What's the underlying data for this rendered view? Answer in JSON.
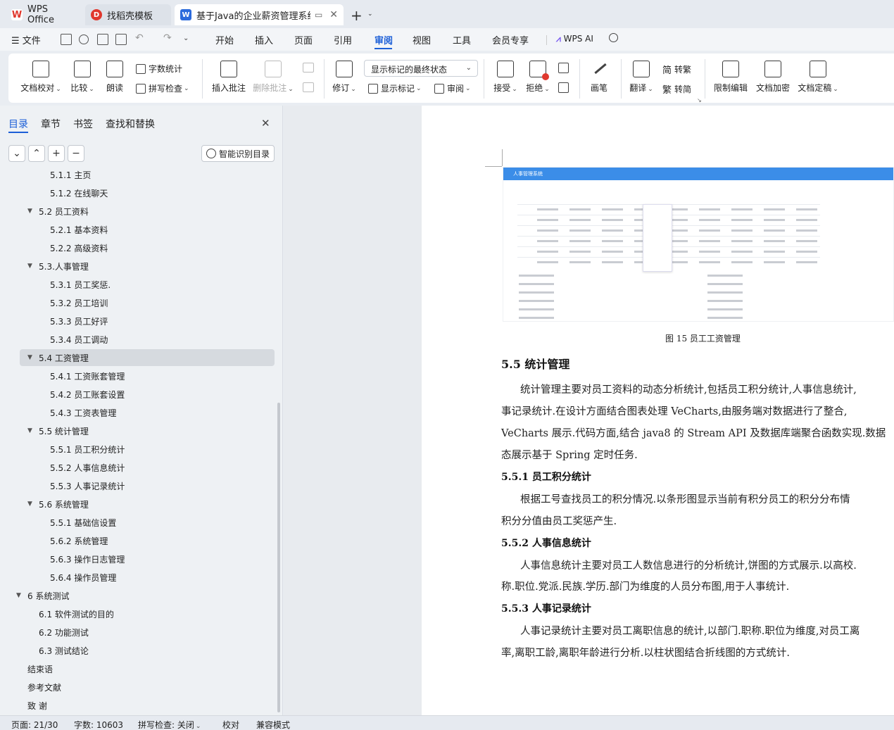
{
  "tabs": [
    {
      "label": "WPS Office",
      "icon": "wps-logo-icon",
      "color": "#e0382e"
    },
    {
      "label": "找稻壳模板",
      "icon": "docer-icon",
      "color": "#e0382e"
    },
    {
      "label": "基于Java的企业薪资管理系统",
      "icon": "word-doc-icon",
      "color": "#2c6bdc"
    }
  ],
  "menu": {
    "file": "文件",
    "items": [
      "开始",
      "插入",
      "页面",
      "引用",
      "审阅",
      "视图",
      "工具",
      "会员专享"
    ],
    "active": "审阅",
    "ai": "WPS AI"
  },
  "ribbon": {
    "doc_proof": "文档校对",
    "compare": "比较",
    "read_aloud": "朗读",
    "word_count": "字数统计",
    "spell_check": "拼写检查",
    "insert_comment": "插入批注",
    "delete_comment": "删除批注",
    "track_changes": "修订",
    "markup_state": "显示标记的最终状态",
    "show_markup": "显示标记",
    "review": "审阅",
    "accept": "接受",
    "reject": "拒绝",
    "pen": "画笔",
    "translate": "翻译",
    "to_traditional": "转繁",
    "to_simplified": "转简",
    "restrict_edit": "限制编辑",
    "encrypt": "文档加密",
    "finalize": "文档定稿"
  },
  "nav": {
    "tabs": [
      "目录",
      "章节",
      "书签",
      "查找和替换"
    ],
    "smart_toc": "智能识别目录",
    "toc": [
      {
        "label": "5.1.1 主页",
        "level": 3
      },
      {
        "label": "5.1.2 在线聊天",
        "level": 3
      },
      {
        "label": "5.2  员工资料",
        "level": 2,
        "expanded": true
      },
      {
        "label": "5.2.1 基本资料",
        "level": 3
      },
      {
        "label": "5.2.2  高级资料",
        "level": 3
      },
      {
        "label": "5.3.人事管理",
        "level": 2,
        "expanded": true
      },
      {
        "label": "5.3.1 员工奖惩.",
        "level": 3
      },
      {
        "label": "5.3.2 员工培训",
        "level": 3
      },
      {
        "label": "5.3.3 员工好评",
        "level": 3
      },
      {
        "label": "5.3.4 员工调动",
        "level": 3
      },
      {
        "label": "5.4 工资管理",
        "level": 2,
        "expanded": true,
        "selected": true
      },
      {
        "label": "5.4.1 工资账套管理",
        "level": 3
      },
      {
        "label": "5.4.2 员工账套设置",
        "level": 3
      },
      {
        "label": "5.4.3 工资表管理",
        "level": 3
      },
      {
        "label": "5.5 统计管理",
        "level": 2,
        "expanded": true
      },
      {
        "label": "5.5.1 员工积分统计",
        "level": 3
      },
      {
        "label": "5.5.2 人事信息统计",
        "level": 3
      },
      {
        "label": "5.5.3 人事记录统计",
        "level": 3
      },
      {
        "label": "5.6 系统管理",
        "level": 2,
        "expanded": true
      },
      {
        "label": "5.5.1 基础信设置",
        "level": 3
      },
      {
        "label": "5.6.2 系统管理",
        "level": 3
      },
      {
        "label": "5.6.3 操作日志管理",
        "level": 3
      },
      {
        "label": "5.6.4 操作员管理",
        "level": 3
      },
      {
        "label": "6 系统测试",
        "level": 1,
        "expanded": true
      },
      {
        "label": "6.1  软件测试的目的",
        "level": 2
      },
      {
        "label": "6.2  功能测试",
        "level": 2
      },
      {
        "label": "6.3  测试结论",
        "level": 2
      },
      {
        "label": "结束语",
        "level": 1
      },
      {
        "label": "参考文献",
        "level": 1
      },
      {
        "label": "致   谢",
        "level": 1
      }
    ]
  },
  "document": {
    "figure_title": "人事管理系统",
    "caption": "图 15 员工工资管理",
    "section": "5.5 统计管理",
    "p1": [
      "统计管理主要对员工资料的动态分析统计,包括员工积分统计,人事信息统计,",
      "事记录统计.在设计方面结合图表处理 VeCharts,由服务端对数据进行了整合,",
      "VeCharts 展示.代码方面,结合 java8 的 Stream API 及数据库端聚合函数实现.数据",
      "态展示基于 Spring 定时任务."
    ],
    "h551": "5.5.1 员工积分统计",
    "p2": [
      "根据工号查找员工的积分情况.以条形图显示当前有积分员工的积分分布情",
      "积分分值由员工奖惩产生."
    ],
    "h552": "5.5.2 人事信息统计",
    "p3": [
      "人事信息统计主要对员工人数信息进行的分析统计,饼图的方式展示.以高校.",
      "称.职位.党派.民族.学历.部门为维度的人员分布图,用于人事统计."
    ],
    "h553": "5.5.3 人事记录统计",
    "p4": [
      "人事记录统计主要对员工离职信息的统计,以部门.职称.职位为维度,对员工离",
      "率,离职工龄,离职年龄进行分析.以柱状图结合折线图的方式统计."
    ]
  },
  "status": {
    "page": "页面: 21/30",
    "words": "字数: 10603",
    "spell": "拼写检查: 关闭",
    "proof": "校对",
    "compat": "兼容模式"
  }
}
